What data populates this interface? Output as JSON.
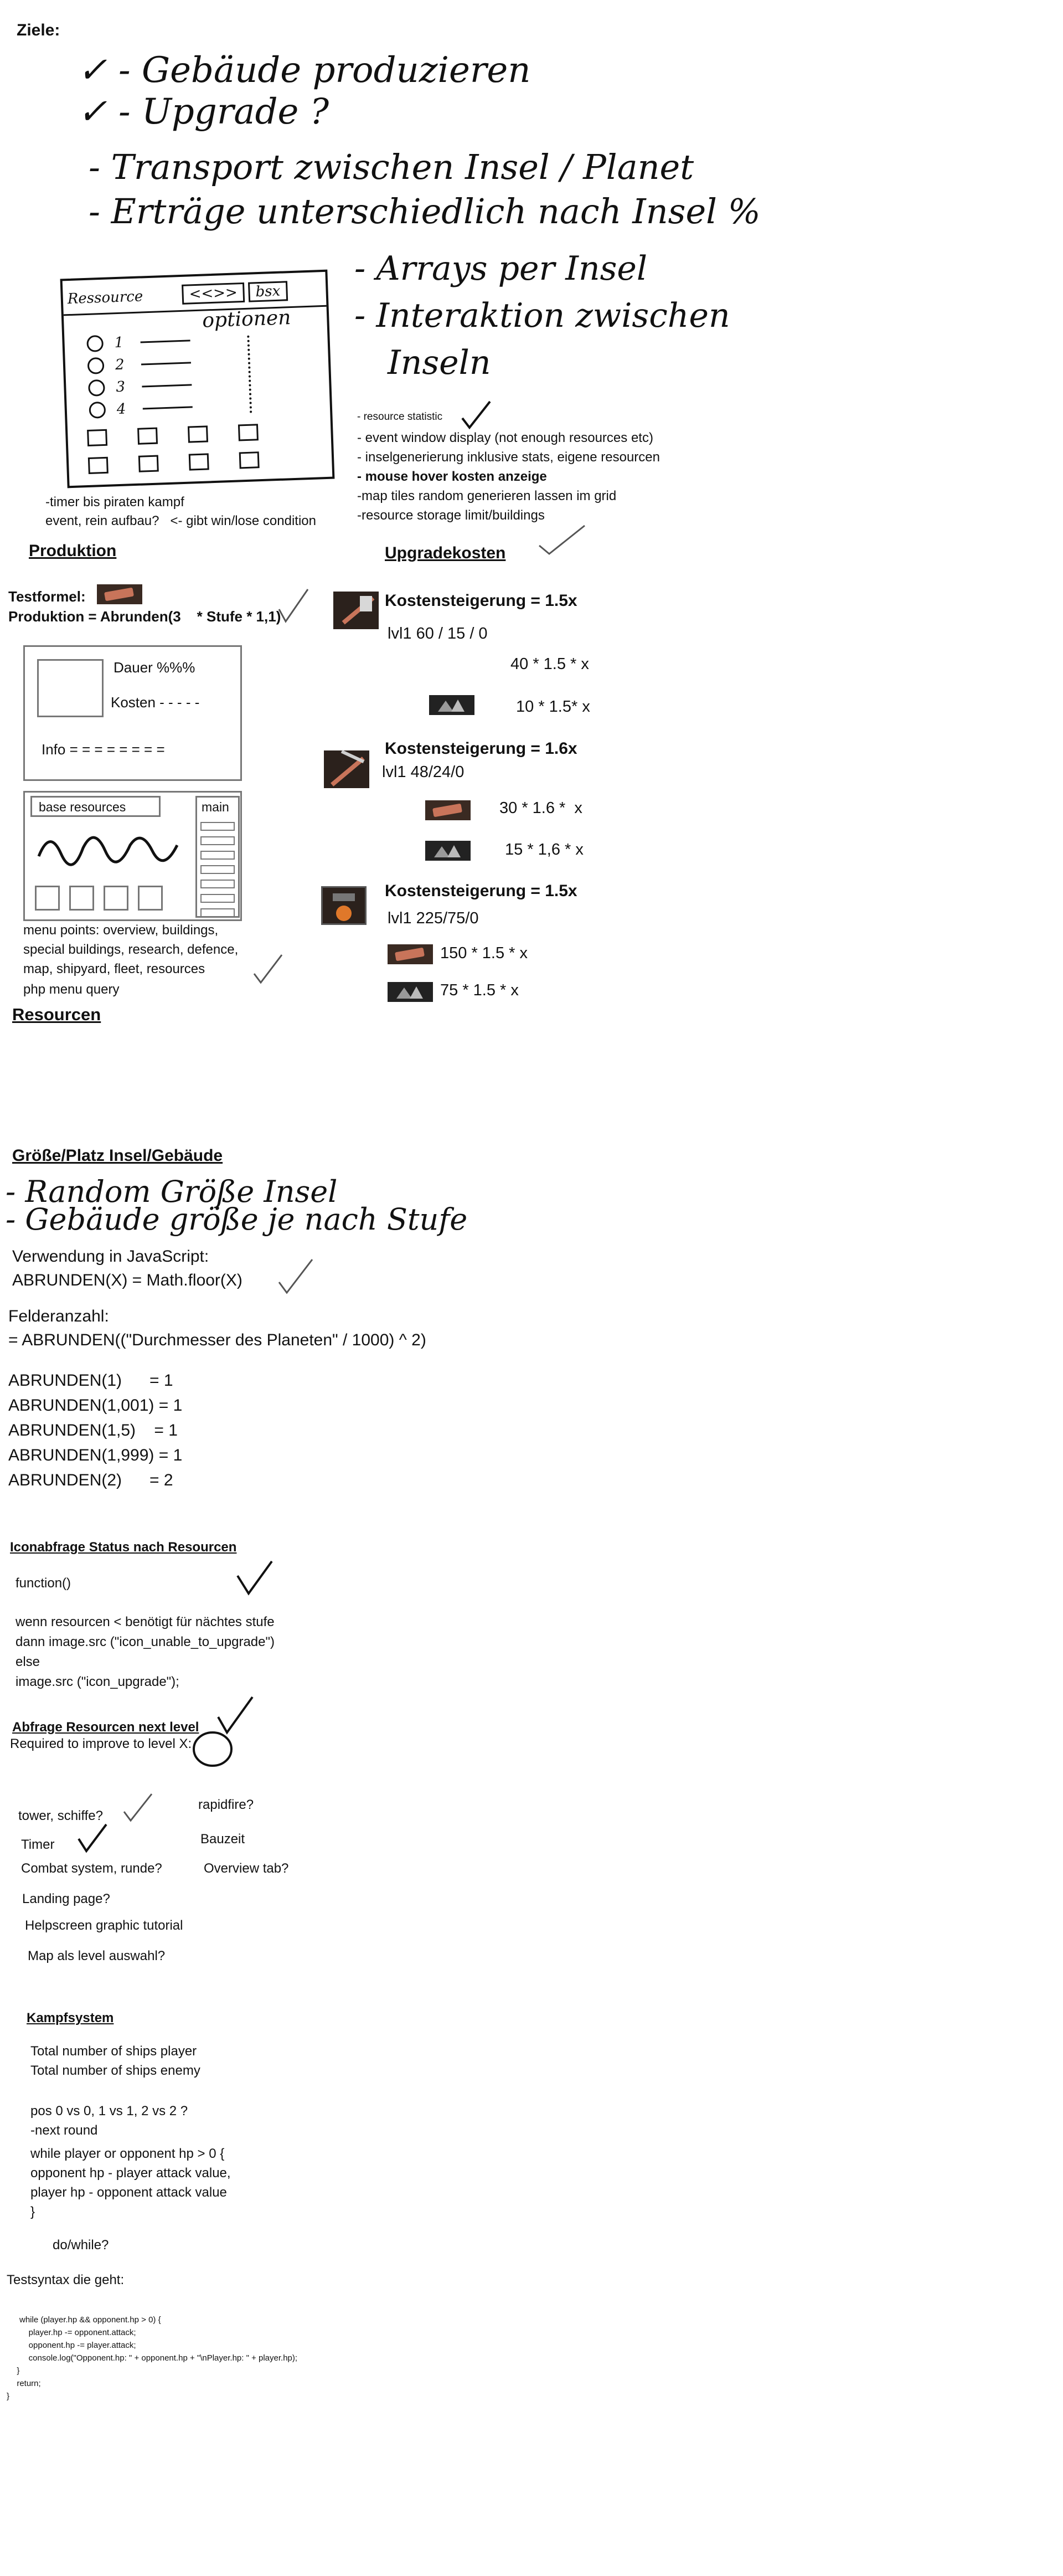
{
  "header": {
    "title": "Ziele:"
  },
  "goals_handwritten": {
    "line1": "✓ - Gebäude produzieren",
    "line2": "✓ - Upgrade ?",
    "line3": "- Transport zwischen Insel / Planet",
    "line4": "- Erträge unterschiedlich nach Insel %",
    "line5": "- Arrays per Insel",
    "line6": "- Interaktion zwischen",
    "line7": "Inseln"
  },
  "sketch_panel": {
    "tab1": "Ressource",
    "tab2": "<<>>",
    "tab3": "bsx",
    "options": "optionen",
    "row_nums": [
      "1",
      "2",
      "3",
      "4"
    ]
  },
  "todo_list": [
    "- resource statistic",
    "- event window display (not enough resources etc)",
    "- inselgenerierung inklusive stats, eigene resourcen",
    "- mouse hover kosten anzeige",
    "-map tiles random generieren lassen im grid",
    "-resource storage limit/buildings"
  ],
  "pirates_note": {
    "line1": "-timer bis piraten kampf",
    "line2": "event, rein aufbau?   <- gibt win/lose condition"
  },
  "produktion": {
    "heading": "Produktion",
    "testformel_label": "Testformel:",
    "formula": "Produktion = Abrunden(3    * Stufe * 1,1)"
  },
  "wireframe_info": {
    "dauer": "Dauer %%%",
    "kosten": "Kosten - - - - -",
    "info": "Info = = = = = = = ="
  },
  "wireframe_main": {
    "base_resources": "base resources",
    "main": "main"
  },
  "menu_points": {
    "line1": "menu points: overview, buildings,",
    "line2": "special buildings, research, defence,",
    "line3": "map, shipyard, fleet, resources",
    "line4": "php menu query"
  },
  "upgrade": {
    "heading": "Upgradekosten",
    "blocks": [
      {
        "title": "Kostensteigerung = 1.5x",
        "level": "lvl1 60 / 15 / 0",
        "cost1": "40 * 1.5 * x",
        "cost2": "10 * 1.5* x"
      },
      {
        "title": "Kostensteigerung = 1.6x",
        "level": "lvl1 48/24/0",
        "cost1": "30 * 1.6 *  x",
        "cost2": "15 * 1,6 * x"
      },
      {
        "title": "Kostensteigerung = 1.5x",
        "level": "lvl1 225/75/0",
        "cost1": "150 * 1.5 * x",
        "cost2": "75 * 1.5 * x"
      }
    ]
  },
  "resourcen": {
    "heading": "Resourcen"
  },
  "groesse": {
    "heading": "Größe/Platz Insel/Gebäude",
    "hw1": "- Random Größe Insel",
    "hw2": "- Gebäude größe je nach Stufe",
    "js_label": "Verwendung in JavaScript:",
    "js_formula": "ABRUNDEN(X) = Math.floor(X)",
    "felder_label": "Felderanzahl:",
    "felder_formula": "= ABRUNDEN((\"Durchmesser des Planeten\" / 1000) ^ 2)",
    "examples": [
      "ABRUNDEN(1)      = 1",
      "ABRUNDEN(1,001) = 1",
      "ABRUNDEN(1,5)    = 1",
      "ABRUNDEN(1,999) = 1",
      "ABRUNDEN(2)      = 2"
    ]
  },
  "iconabfrage": {
    "heading": "Iconabfrage Status nach Resourcen",
    "function": "function()",
    "lines": [
      "wenn resourcen < benötigt für nächtes stufe",
      "dann image.src (\"icon_unable_to_upgrade\")",
      "else",
      "image.src (\"icon_upgrade\");"
    ]
  },
  "abfrage": {
    "heading": "Abfrage Resourcen next level",
    "required": "Required to improve to level X:"
  },
  "misc": {
    "tower": "tower, schiffe?",
    "rapidfire": "rapidfire?",
    "timer": "Timer",
    "bauzeit": "Bauzeit",
    "combat": "Combat system, runde?",
    "overview": "Overview tab?",
    "landing": "Landing page?",
    "help": "Helpscreen graphic tutorial",
    "map": "Map als level auswahl?"
  },
  "kampf": {
    "heading": "Kampfsystem",
    "lines": [
      "Total number of ships player",
      "Total number of ships enemy",
      "",
      "pos 0 vs 0, 1 vs 1, 2 vs 2 ?",
      "-next round",
      "while player or opponent hp > 0 {",
      "opponent hp - player attack value,",
      "player hp - opponent attack value",
      "}"
    ],
    "dowhile": "do/while?"
  },
  "testsyntax": {
    "label": "Testsyntax die geht:",
    "code": [
      "while (player.hp && opponent.hp > 0) {",
      "    player.hp -= opponent.attack;",
      "    opponent.hp -= player.attack;",
      "    console.log(\"Opponent.hp: \" + opponent.hp + \"\\nPlayer.hp: \" + player.hp);",
      "  }",
      "  return;",
      "}"
    ]
  },
  "colors": {
    "ink": "#111111",
    "box_border": "#777777",
    "icon_bg": "#3a2a22",
    "copper": "#c8745a"
  }
}
